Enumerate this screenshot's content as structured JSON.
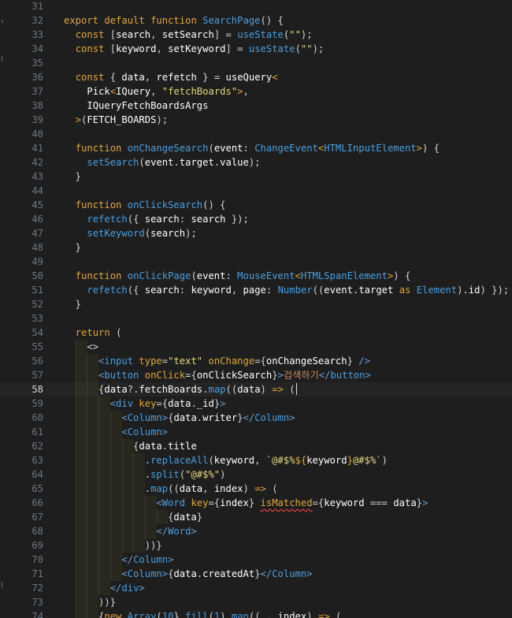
{
  "editor": {
    "current_line": 58,
    "line_numbers": [
      "31",
      "32",
      "33",
      "34",
      "35",
      "36",
      "37",
      "38",
      "39",
      "40",
      "41",
      "42",
      "43",
      "44",
      "45",
      "46",
      "47",
      "48",
      "49",
      "50",
      "51",
      "52",
      "53",
      "54",
      "55",
      "56",
      "57",
      "58",
      "59",
      "60",
      "61",
      "62",
      "63",
      "64",
      "65",
      "66",
      "67",
      "68",
      "69",
      "70",
      "71",
      "72",
      "73",
      "74"
    ],
    "colors": {
      "keyword": "#e0a73c",
      "function": "#4a9fe0",
      "variable": "#ffffff",
      "string": "#e4d97a",
      "tag": "#6a9fd1",
      "punct": "#d4d4d4",
      "korean": "#c98a62"
    },
    "gutter_icons": [
      "fold-icon",
      "fold-icon",
      "fold-icon"
    ],
    "lines": [
      [
        [
          "punct",
          ""
        ]
      ],
      [
        [
          "keyword",
          "export "
        ],
        [
          "keyword",
          "default "
        ],
        [
          "keyword",
          "function "
        ],
        [
          "function",
          "SearchPage"
        ],
        [
          "punct",
          "() {"
        ]
      ],
      [
        [
          "punct",
          "  "
        ],
        [
          "keyword",
          "const "
        ],
        [
          "punct",
          "["
        ],
        [
          "variable",
          "search"
        ],
        [
          "punct",
          ", "
        ],
        [
          "variable",
          "setSearch"
        ],
        [
          "punct",
          "] = "
        ],
        [
          "function",
          "useState"
        ],
        [
          "punct",
          "("
        ],
        [
          "string",
          "\"\""
        ],
        [
          "punct",
          ");"
        ]
      ],
      [
        [
          "punct",
          "  "
        ],
        [
          "keyword",
          "const "
        ],
        [
          "punct",
          "["
        ],
        [
          "variable",
          "keyword"
        ],
        [
          "punct",
          ", "
        ],
        [
          "variable",
          "setKeyword"
        ],
        [
          "punct",
          "] = "
        ],
        [
          "function",
          "useState"
        ],
        [
          "punct",
          "("
        ],
        [
          "string",
          "\"\""
        ],
        [
          "punct",
          ");"
        ]
      ],
      [
        [
          "punct",
          ""
        ]
      ],
      [
        [
          "punct",
          "  "
        ],
        [
          "keyword",
          "const "
        ],
        [
          "punct",
          "{ "
        ],
        [
          "variable",
          "data"
        ],
        [
          "punct",
          ", "
        ],
        [
          "variable",
          "refetch"
        ],
        [
          "punct",
          " } = "
        ],
        [
          "variable",
          "useQuery"
        ],
        [
          "keyword",
          "<"
        ]
      ],
      [
        [
          "punct",
          "    "
        ],
        [
          "variable",
          "Pick"
        ],
        [
          "keyword",
          "<"
        ],
        [
          "variable",
          "IQuery"
        ],
        [
          "punct",
          ", "
        ],
        [
          "string",
          "\"fetchBoards\""
        ],
        [
          "keyword",
          ">"
        ],
        [
          "punct",
          ","
        ]
      ],
      [
        [
          "punct",
          "    "
        ],
        [
          "variable",
          "IQueryFetchBoardsArgs"
        ]
      ],
      [
        [
          "punct",
          "  "
        ],
        [
          "keyword",
          ">"
        ],
        [
          "punct",
          "("
        ],
        [
          "variable",
          "FETCH_BOARDS"
        ],
        [
          "punct",
          ");"
        ]
      ],
      [
        [
          "punct",
          ""
        ]
      ],
      [
        [
          "punct",
          "  "
        ],
        [
          "keyword",
          "function "
        ],
        [
          "function",
          "onChangeSearch"
        ],
        [
          "punct",
          "("
        ],
        [
          "variable",
          "event"
        ],
        [
          "punct",
          ": "
        ],
        [
          "function",
          "ChangeEvent"
        ],
        [
          "keyword",
          "<"
        ],
        [
          "function",
          "HTMLInputElement"
        ],
        [
          "keyword",
          ">"
        ],
        [
          "punct",
          ") {"
        ]
      ],
      [
        [
          "punct",
          "    "
        ],
        [
          "function",
          "setSearch"
        ],
        [
          "punct",
          "("
        ],
        [
          "variable",
          "event"
        ],
        [
          "punct",
          "."
        ],
        [
          "variable",
          "target"
        ],
        [
          "punct",
          "."
        ],
        [
          "variable",
          "value"
        ],
        [
          "punct",
          ");"
        ]
      ],
      [
        [
          "punct",
          "  }"
        ]
      ],
      [
        [
          "punct",
          ""
        ]
      ],
      [
        [
          "punct",
          "  "
        ],
        [
          "keyword",
          "function "
        ],
        [
          "function",
          "onClickSearch"
        ],
        [
          "punct",
          "() {"
        ]
      ],
      [
        [
          "punct",
          "    "
        ],
        [
          "function",
          "refetch"
        ],
        [
          "punct",
          "({ "
        ],
        [
          "variable",
          "search"
        ],
        [
          "punct",
          ": "
        ],
        [
          "variable",
          "search"
        ],
        [
          "punct",
          " });"
        ]
      ],
      [
        [
          "punct",
          "    "
        ],
        [
          "function",
          "setKeyword"
        ],
        [
          "punct",
          "("
        ],
        [
          "variable",
          "search"
        ],
        [
          "punct",
          ");"
        ]
      ],
      [
        [
          "punct",
          "  }"
        ]
      ],
      [
        [
          "punct",
          ""
        ]
      ],
      [
        [
          "punct",
          "  "
        ],
        [
          "keyword",
          "function "
        ],
        [
          "function",
          "onClickPage"
        ],
        [
          "punct",
          "("
        ],
        [
          "variable",
          "event"
        ],
        [
          "punct",
          ": "
        ],
        [
          "function",
          "MouseEvent"
        ],
        [
          "keyword",
          "<"
        ],
        [
          "function",
          "HTMLSpanElement"
        ],
        [
          "keyword",
          ">"
        ],
        [
          "punct",
          ") {"
        ]
      ],
      [
        [
          "punct",
          "    "
        ],
        [
          "function",
          "refetch"
        ],
        [
          "punct",
          "({ "
        ],
        [
          "variable",
          "search"
        ],
        [
          "punct",
          ": "
        ],
        [
          "variable",
          "keyword"
        ],
        [
          "punct",
          ", "
        ],
        [
          "variable",
          "page"
        ],
        [
          "punct",
          ": "
        ],
        [
          "function",
          "Number"
        ],
        [
          "punct",
          "(("
        ],
        [
          "variable",
          "event"
        ],
        [
          "punct",
          "."
        ],
        [
          "variable",
          "target"
        ],
        [
          "keyword",
          " as "
        ],
        [
          "function",
          "Element"
        ],
        [
          "punct",
          ")."
        ],
        [
          "variable",
          "id"
        ],
        [
          "punct",
          ") });"
        ]
      ],
      [
        [
          "punct",
          "  }"
        ]
      ],
      [
        [
          "punct",
          ""
        ]
      ],
      [
        [
          "punct",
          "  "
        ],
        [
          "keyword",
          "return "
        ],
        [
          "punct",
          "("
        ]
      ],
      [
        [
          "punct",
          "    "
        ],
        [
          "punct",
          "<>"
        ]
      ],
      [
        [
          "punct",
          "      "
        ],
        [
          "tag",
          "<"
        ],
        [
          "function",
          "input "
        ],
        [
          "keyword",
          "type"
        ],
        [
          "punct",
          "="
        ],
        [
          "string",
          "\"text\" "
        ],
        [
          "keyword",
          "onChange"
        ],
        [
          "punct",
          "={"
        ],
        [
          "variable",
          "onChangeSearch"
        ],
        [
          "punct",
          "} "
        ],
        [
          "tag",
          "/>"
        ]
      ],
      [
        [
          "punct",
          "      "
        ],
        [
          "tag",
          "<"
        ],
        [
          "function",
          "button "
        ],
        [
          "keyword",
          "onClick"
        ],
        [
          "punct",
          "={"
        ],
        [
          "variable",
          "onClickSearch"
        ],
        [
          "punct",
          "}"
        ],
        [
          "tag",
          ">"
        ],
        [
          "korean",
          "검색하기"
        ],
        [
          "tag",
          "</"
        ],
        [
          "function",
          "button"
        ],
        [
          "tag",
          ">"
        ]
      ],
      [
        [
          "punct",
          "      {"
        ],
        [
          "variable",
          "data"
        ],
        [
          "punct",
          "?."
        ],
        [
          "variable",
          "fetchBoards"
        ],
        [
          "punct",
          "."
        ],
        [
          "function",
          "map"
        ],
        [
          "punct",
          "(("
        ],
        [
          "variable",
          "data"
        ],
        [
          "punct",
          ") "
        ],
        [
          "keyword",
          "=>"
        ],
        [
          "punct",
          " ("
        ]
      ],
      [
        [
          "punct",
          "        "
        ],
        [
          "tag",
          "<"
        ],
        [
          "function",
          "div "
        ],
        [
          "keyword",
          "key"
        ],
        [
          "punct",
          "={"
        ],
        [
          "variable",
          "data"
        ],
        [
          "punct",
          "."
        ],
        [
          "variable",
          "_id"
        ],
        [
          "punct",
          "}"
        ],
        [
          "tag",
          ">"
        ]
      ],
      [
        [
          "punct",
          "          "
        ],
        [
          "tag",
          "<"
        ],
        [
          "function",
          "Column"
        ],
        [
          "tag",
          ">"
        ],
        [
          "punct",
          "{"
        ],
        [
          "variable",
          "data"
        ],
        [
          "punct",
          "."
        ],
        [
          "variable",
          "writer"
        ],
        [
          "punct",
          "}"
        ],
        [
          "tag",
          "</"
        ],
        [
          "function",
          "Column"
        ],
        [
          "tag",
          ">"
        ]
      ],
      [
        [
          "punct",
          "          "
        ],
        [
          "tag",
          "<"
        ],
        [
          "function",
          "Column"
        ],
        [
          "tag",
          ">"
        ]
      ],
      [
        [
          "punct",
          "            {"
        ],
        [
          "variable",
          "data"
        ],
        [
          "punct",
          "."
        ],
        [
          "variable",
          "title"
        ]
      ],
      [
        [
          "punct",
          "              ."
        ],
        [
          "function",
          "replaceAll"
        ],
        [
          "punct",
          "("
        ],
        [
          "variable",
          "keyword"
        ],
        [
          "punct",
          ", "
        ],
        [
          "string",
          "`@#$%"
        ],
        [
          "keyword",
          "${"
        ],
        [
          "variable",
          "keyword"
        ],
        [
          "keyword",
          "}"
        ],
        [
          "string",
          "@#$%`"
        ],
        [
          "punct",
          ")"
        ]
      ],
      [
        [
          "punct",
          "              ."
        ],
        [
          "function",
          "split"
        ],
        [
          "punct",
          "("
        ],
        [
          "string",
          "\"@#$%\""
        ],
        [
          "punct",
          ")"
        ]
      ],
      [
        [
          "punct",
          "              ."
        ],
        [
          "function",
          "map"
        ],
        [
          "punct",
          "(("
        ],
        [
          "variable",
          "data"
        ],
        [
          "punct",
          ", "
        ],
        [
          "variable",
          "index"
        ],
        [
          "punct",
          ") "
        ],
        [
          "keyword",
          "=>"
        ],
        [
          "punct",
          " ("
        ]
      ],
      [
        [
          "punct",
          "                "
        ],
        [
          "tag",
          "<"
        ],
        [
          "function",
          "Word "
        ],
        [
          "keyword",
          "key"
        ],
        [
          "punct",
          "={"
        ],
        [
          "variable",
          "index"
        ],
        [
          "punct",
          "} "
        ],
        [
          "keyword",
          "isMatched"
        ],
        [
          "punct",
          "={"
        ],
        [
          "variable",
          "keyword"
        ],
        [
          "punct",
          " === "
        ],
        [
          "variable",
          "data"
        ],
        [
          "punct",
          "}"
        ],
        [
          "tag",
          ">"
        ]
      ],
      [
        [
          "punct",
          "                  {"
        ],
        [
          "variable",
          "data"
        ],
        [
          "punct",
          "}"
        ]
      ],
      [
        [
          "punct",
          "                "
        ],
        [
          "tag",
          "</"
        ],
        [
          "function",
          "Word"
        ],
        [
          "tag",
          ">"
        ]
      ],
      [
        [
          "punct",
          "              ))"
        ],
        [
          "punct",
          "}"
        ]
      ],
      [
        [
          "punct",
          "          "
        ],
        [
          "tag",
          "</"
        ],
        [
          "function",
          "Column"
        ],
        [
          "tag",
          ">"
        ]
      ],
      [
        [
          "punct",
          "          "
        ],
        [
          "tag",
          "<"
        ],
        [
          "function",
          "Column"
        ],
        [
          "tag",
          ">"
        ],
        [
          "punct",
          "{"
        ],
        [
          "variable",
          "data"
        ],
        [
          "punct",
          "."
        ],
        [
          "variable",
          "createdAt"
        ],
        [
          "punct",
          "}"
        ],
        [
          "tag",
          "</"
        ],
        [
          "function",
          "Column"
        ],
        [
          "tag",
          ">"
        ]
      ],
      [
        [
          "punct",
          "        "
        ],
        [
          "tag",
          "</"
        ],
        [
          "function",
          "div"
        ],
        [
          "tag",
          ">"
        ]
      ],
      [
        [
          "punct",
          "      ))}"
        ]
      ],
      [
        [
          "punct",
          "      {"
        ],
        [
          "keyword",
          "new "
        ],
        [
          "function",
          "Array"
        ],
        [
          "punct",
          "("
        ],
        [
          "function",
          "10"
        ],
        [
          "punct",
          "}."
        ],
        [
          "function",
          "fill"
        ],
        [
          "punct",
          "("
        ],
        [
          "function",
          "1"
        ],
        [
          "punct",
          ")."
        ],
        [
          "function",
          "map"
        ],
        [
          "punct",
          "((_, "
        ],
        [
          "variable",
          "index"
        ],
        [
          "punct",
          ") "
        ],
        [
          "keyword",
          "=>"
        ],
        [
          "punct",
          " ("
        ]
      ]
    ]
  }
}
